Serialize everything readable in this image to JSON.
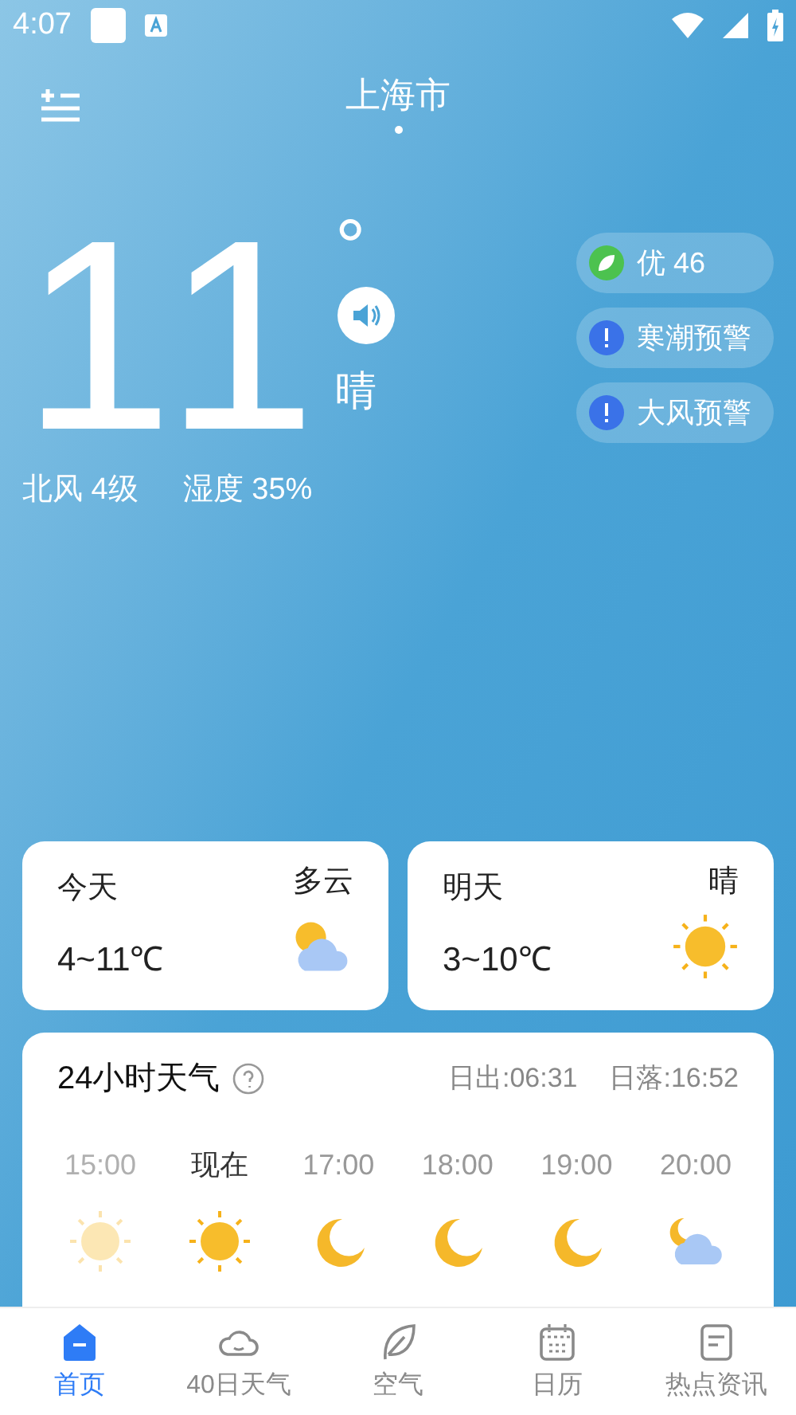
{
  "status_bar": {
    "time": "4:07"
  },
  "header": {
    "city": "上海市"
  },
  "current": {
    "temperature": "11",
    "degree": "°",
    "condition": "晴",
    "wind": "北风 4级",
    "humidity": "湿度 35%"
  },
  "badges": [
    {
      "kind": "air",
      "label": "优 46"
    },
    {
      "kind": "warning",
      "label": "寒潮预警"
    },
    {
      "kind": "warning",
      "label": "大风预警"
    }
  ],
  "days": [
    {
      "label": "今天",
      "condition": "多云",
      "range": "4~11℃",
      "kind": "partly"
    },
    {
      "label": "明天",
      "condition": "晴",
      "range": "3~10℃",
      "kind": "sun"
    }
  ],
  "hourly": {
    "title": "24小时天气",
    "sunrise": "日出:06:31",
    "sunset": "日落:16:52",
    "hours": [
      {
        "time": "15:00",
        "kind": "sun",
        "past": true,
        "current": false
      },
      {
        "time": "现在",
        "kind": "sun",
        "past": false,
        "current": true
      },
      {
        "time": "17:00",
        "kind": "moon",
        "past": false,
        "current": false
      },
      {
        "time": "18:00",
        "kind": "moon",
        "past": false,
        "current": false
      },
      {
        "time": "19:00",
        "kind": "moon",
        "past": false,
        "current": false
      },
      {
        "time": "20:00",
        "kind": "partly-night",
        "past": false,
        "current": false
      }
    ]
  },
  "nav": [
    {
      "label": "首页",
      "kind": "home",
      "selected": true
    },
    {
      "label": "40日天气",
      "kind": "cloud",
      "selected": false
    },
    {
      "label": "空气",
      "kind": "leaf",
      "selected": false
    },
    {
      "label": "日历",
      "kind": "calendar",
      "selected": false
    },
    {
      "label": "热点资讯",
      "kind": "news",
      "selected": false
    }
  ]
}
